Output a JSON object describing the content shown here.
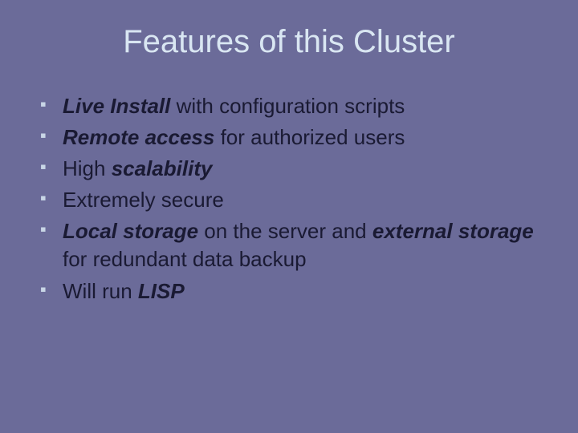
{
  "title": "Features of this Cluster",
  "bullets": [
    {
      "spans": [
        {
          "t": "Live Install",
          "e": true
        },
        {
          "t": " with configuration scripts",
          "e": false
        }
      ]
    },
    {
      "spans": [
        {
          "t": "Remote access",
          "e": true
        },
        {
          "t": " for authorized users",
          "e": false
        }
      ]
    },
    {
      "spans": [
        {
          "t": "High ",
          "e": false
        },
        {
          "t": "scalability",
          "e": true
        }
      ]
    },
    {
      "spans": [
        {
          "t": "Extremely secure",
          "e": false
        }
      ]
    },
    {
      "spans": [
        {
          "t": "Local storage",
          "e": true
        },
        {
          "t": " on the server and ",
          "e": false
        },
        {
          "t": "external storage",
          "e": true
        },
        {
          "t": " for redundant data backup",
          "e": false
        }
      ]
    },
    {
      "spans": [
        {
          "t": "Will run ",
          "e": false
        },
        {
          "t": "LISP",
          "e": true
        }
      ]
    }
  ]
}
